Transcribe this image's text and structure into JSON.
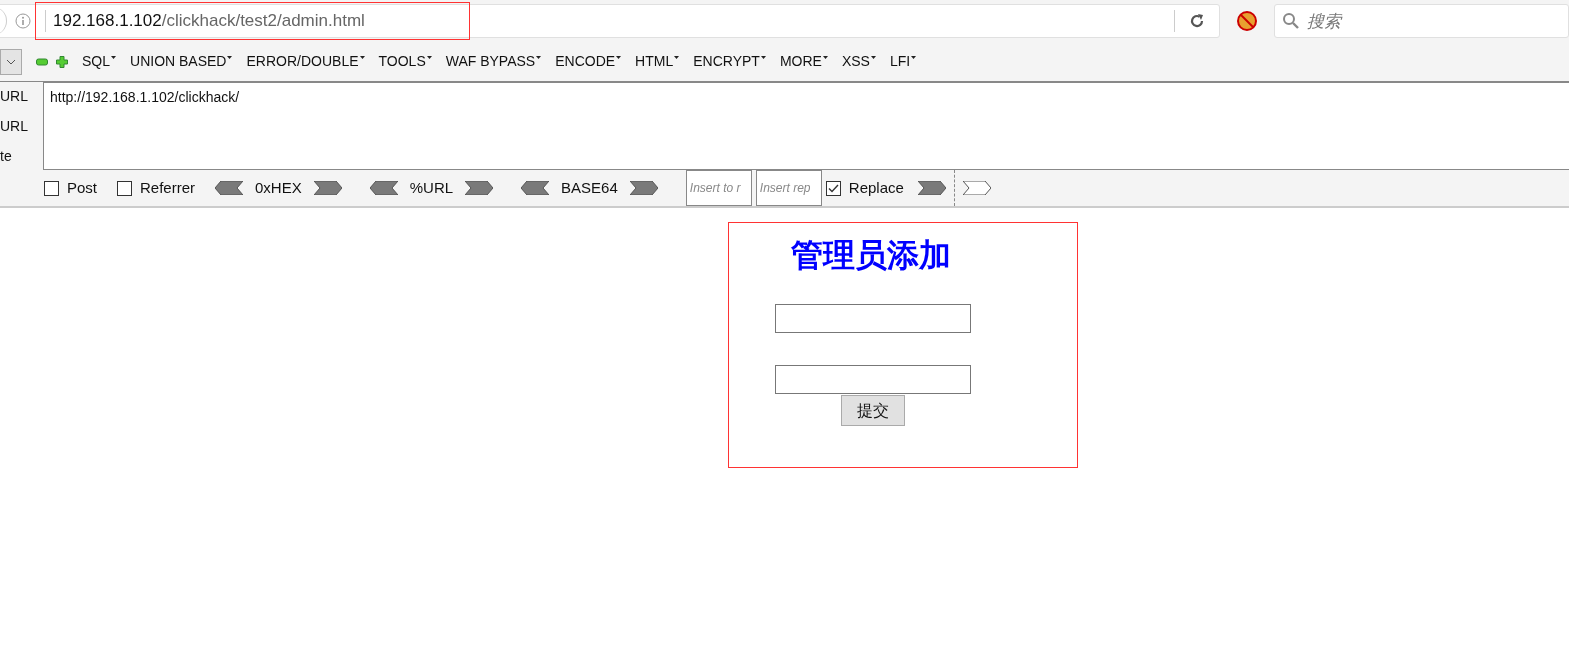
{
  "address_bar": {
    "host": "192.168.1.102",
    "path": "/clickhack/test2/admin.html"
  },
  "search": {
    "placeholder": "搜索"
  },
  "hackbar": {
    "menus": [
      "SQL",
      "UNION BASED",
      "ERROR/DOUBLE",
      "TOOLS",
      "WAF BYPASS",
      "ENCODE",
      "HTML",
      "ENCRYPT",
      "MORE",
      "XSS",
      "LFI"
    ],
    "side_labels": [
      "URL",
      "URL",
      "te"
    ],
    "url_value": "http://192.168.1.102/clickhack/",
    "options": [
      {
        "kind": "checkbox",
        "label": "Post",
        "checked": false
      },
      {
        "kind": "checkbox",
        "label": "Referrer",
        "checked": false
      },
      {
        "kind": "encoder",
        "label": "0xHEX"
      },
      {
        "kind": "encoder",
        "label": "%URL"
      },
      {
        "kind": "encoder",
        "label": "BASE64"
      },
      {
        "kind": "field",
        "placeholder": "Insert to r"
      },
      {
        "kind": "field",
        "placeholder": "Insert rep"
      },
      {
        "kind": "checkbox",
        "label": "Replace",
        "checked": true
      }
    ]
  },
  "form": {
    "title": "管理员添加",
    "submit": "提交"
  }
}
